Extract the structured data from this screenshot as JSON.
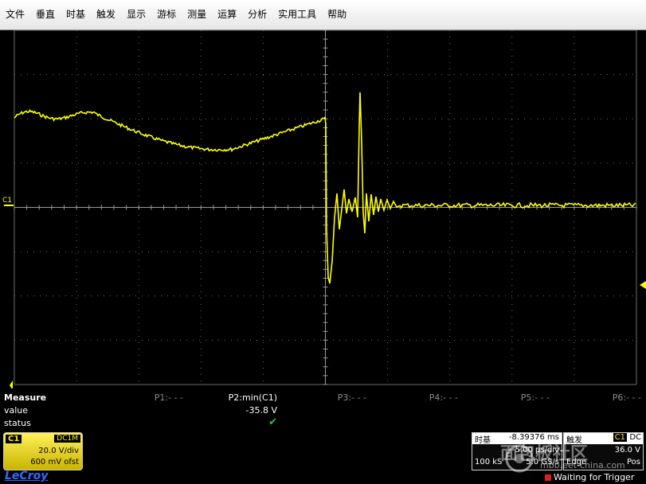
{
  "menu": [
    "文件",
    "垂直",
    "时基",
    "触发",
    "显示",
    "游标",
    "测量",
    "运算",
    "分析",
    "实用工具",
    "帮助"
  ],
  "channel_marker": "C1",
  "measure": {
    "title": "Measure",
    "row_labels": [
      "value",
      "status"
    ],
    "params": [
      {
        "label": "P1:- - -",
        "value": "",
        "status": ""
      },
      {
        "label": "P2:min(C1)",
        "value": "-35.8 V",
        "status": "✔"
      },
      {
        "label": "P3:- - -",
        "value": "",
        "status": ""
      },
      {
        "label": "P4:- - -",
        "value": "",
        "status": ""
      },
      {
        "label": "P5:- - -",
        "value": "",
        "status": ""
      },
      {
        "label": "P6:- - -",
        "value": "",
        "status": ""
      }
    ]
  },
  "channel": {
    "name": "C1",
    "coupling": "DC1M",
    "scale": "20.0 V/div",
    "offset": "600 mV ofst"
  },
  "timebase": {
    "title": "时基",
    "delay": "-8.39376 ms",
    "line2": "5.00 µs/div",
    "line3a": "100 kS",
    "line3b": "5.0 GS/s"
  },
  "trigger": {
    "title": "触发",
    "source": "C1",
    "coupling": "DC",
    "level": "36.0 V",
    "mode": "Edge",
    "slope": "Pos"
  },
  "status_text": "Waiting for Trigger",
  "logo": "LeCroy",
  "watermark": {
    "text": "面包板社区",
    "url": "mbb.eet-china.com"
  },
  "colors": {
    "trace": "#ffff00",
    "grid": "#6e6e6e",
    "background": "#000000"
  }
}
